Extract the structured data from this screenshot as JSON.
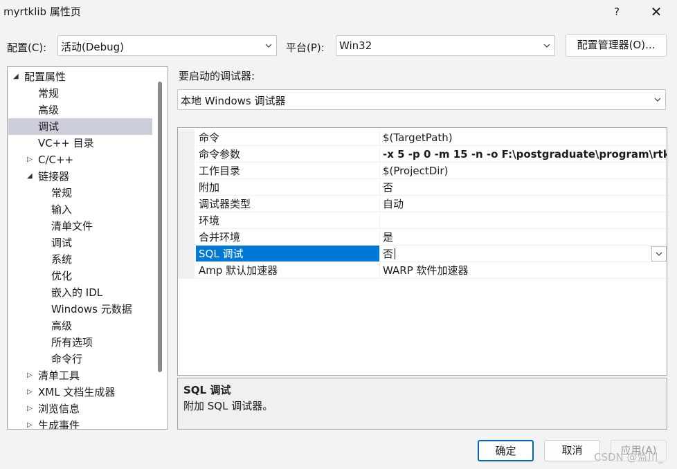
{
  "window": {
    "title": "myrtklib 属性页",
    "help": "?",
    "close": "✕"
  },
  "toolbar": {
    "config_label": "配置(C):",
    "config_value": "活动(Debug)",
    "platform_label": "平台(P):",
    "platform_value": "Win32",
    "config_manager": "配置管理器(O)..."
  },
  "tree": {
    "items": [
      {
        "label": "配置属性",
        "toggle": "◢"
      },
      {
        "label": "常规"
      },
      {
        "label": "高级"
      },
      {
        "label": "调试"
      },
      {
        "label": "VC++ 目录"
      },
      {
        "label": "C/C++",
        "toggle": "▷"
      },
      {
        "label": "链接器",
        "toggle": "◢"
      },
      {
        "label": "常规"
      },
      {
        "label": "输入"
      },
      {
        "label": "清单文件"
      },
      {
        "label": "调试"
      },
      {
        "label": "系统"
      },
      {
        "label": "优化"
      },
      {
        "label": "嵌入的 IDL"
      },
      {
        "label": "Windows 元数据"
      },
      {
        "label": "高级"
      },
      {
        "label": "所有选项"
      },
      {
        "label": "命令行"
      },
      {
        "label": "清单工具",
        "toggle": "▷"
      },
      {
        "label": "XML 文档生成器",
        "toggle": "▷"
      },
      {
        "label": "浏览信息",
        "toggle": "▷"
      },
      {
        "label": "生成事件",
        "toggle": "▷"
      }
    ]
  },
  "debugger": {
    "label": "要启动的调试器:",
    "value": "本地 Windows 调试器"
  },
  "properties": [
    {
      "name": "命令",
      "value": "$(TargetPath)"
    },
    {
      "name": "命令参数",
      "value": "-x 5 -p 0 -m 15 -n -o  F:\\postgraduate\\program\\rtk"
    },
    {
      "name": "工作目录",
      "value": "$(ProjectDir)"
    },
    {
      "name": "附加",
      "value": "否"
    },
    {
      "name": "调试器类型",
      "value": "自动"
    },
    {
      "name": "环境",
      "value": ""
    },
    {
      "name": "合并环境",
      "value": "是"
    },
    {
      "name": "SQL 调试",
      "value": "否"
    },
    {
      "name": "Amp 默认加速器",
      "value": "WARP 软件加速器"
    }
  ],
  "description": {
    "title": "SQL 调试",
    "text": "附加 SQL 调试器。"
  },
  "buttons": {
    "ok": "确定",
    "cancel": "取消",
    "apply": "应用(A)"
  },
  "watermark": "CSDN @监川_",
  "colors": {
    "selection": "#0078d7",
    "tree_selection": "#cccedb",
    "accent_border": "#0067c0"
  }
}
